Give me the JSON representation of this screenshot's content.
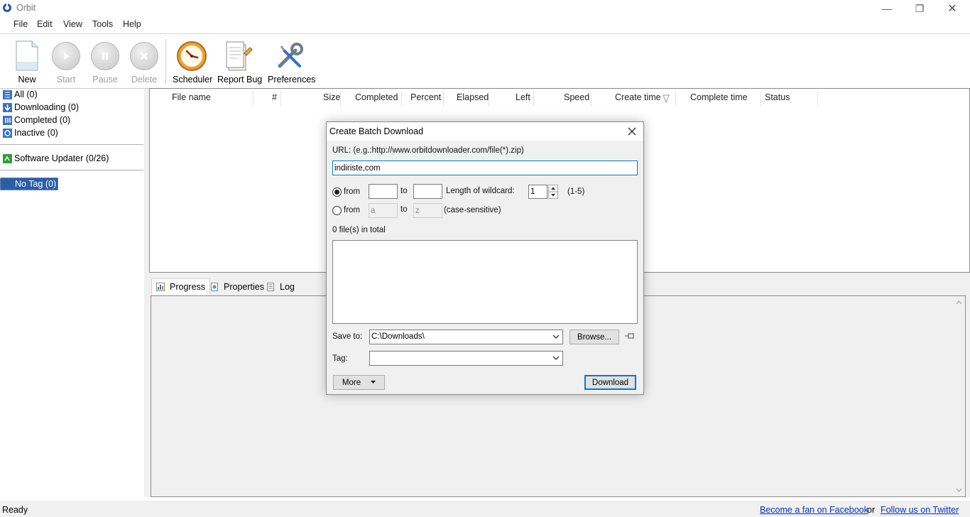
{
  "app": {
    "title": "Orbit"
  },
  "window_controls": {
    "minimize": "—",
    "maximize": "❐",
    "close": "✕"
  },
  "menu": [
    "File",
    "Edit",
    "View",
    "Tools",
    "Help"
  ],
  "toolbar": {
    "new": "New",
    "start": "Start",
    "pause": "Pause",
    "delete": "Delete",
    "scheduler": "Scheduler",
    "report_bug": "Report Bug",
    "preferences": "Preferences"
  },
  "sidebar": {
    "items": [
      {
        "label": "All (0)",
        "icon": "list-icon"
      },
      {
        "label": "Downloading (0)",
        "icon": "download-arrow-icon"
      },
      {
        "label": "Completed (0)",
        "icon": "completed-icon"
      },
      {
        "label": "Inactive (0)",
        "icon": "inactive-icon"
      }
    ],
    "updater": "Software Updater (0/26)",
    "tag": "No Tag (0)"
  },
  "columns": [
    "File name",
    "#",
    "Size",
    "Completed",
    "Percent",
    "Elapsed",
    "Left",
    "Speed",
    "Create time",
    "Complete time",
    "Status"
  ],
  "tabs": [
    "Progress",
    "Properties",
    "Log"
  ],
  "status": {
    "text": "Ready",
    "facebook_link": "Become a fan on Facebook",
    "or": "or",
    "twitter_link": "Follow us on Twitter"
  },
  "dialog": {
    "title": "Create Batch Download",
    "url_label": "URL: (e.g.:http://www.orbitdownloader.com/file(*).zip)",
    "url_value": "indiriste,com",
    "from_label": "from",
    "to_label": "to",
    "from_num": "",
    "to_num": "",
    "wildcard_label": "Length of wildcard:",
    "wildcard_value": "1",
    "wildcard_range": "(1-5)",
    "from_alpha": "a",
    "to_alpha": "z",
    "case_label": "(case-sensitive)",
    "files_total": "0 file(s) in total",
    "save_to_label": "Save to:",
    "save_to_value": "C:\\Downloads\\",
    "browse": "Browse...",
    "tag_label": "Tag:",
    "tag_value": "",
    "more": "More",
    "download": "Download"
  },
  "colors": {
    "selection": "#2a5fa8",
    "link": "#0033cc",
    "focus": "#0078d7"
  }
}
